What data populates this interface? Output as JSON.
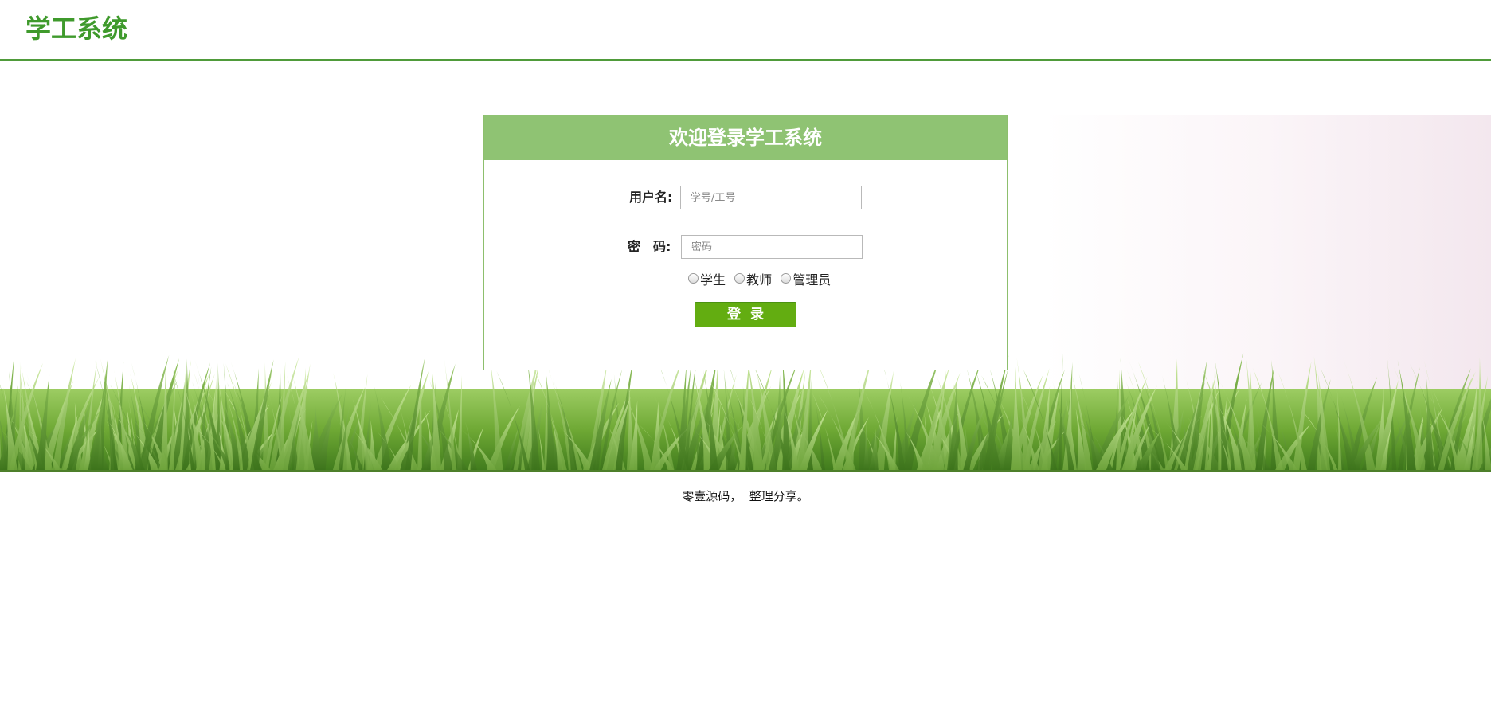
{
  "header": {
    "logo": "学工系统"
  },
  "login": {
    "title": "欢迎登录学工系统",
    "username_label": "用户名:",
    "username_placeholder": "学号/工号",
    "password_label": "密　码:",
    "password_placeholder": "密码",
    "roles": [
      {
        "label": "学生"
      },
      {
        "label": "教师"
      },
      {
        "label": "管理员"
      }
    ],
    "submit_label": "登录"
  },
  "footer": {
    "text": "零壹源码，  整理分享。"
  },
  "colors": {
    "brand_green": "#3f9a2c",
    "title_bar": "#8fc373",
    "button": "#63ad11"
  }
}
